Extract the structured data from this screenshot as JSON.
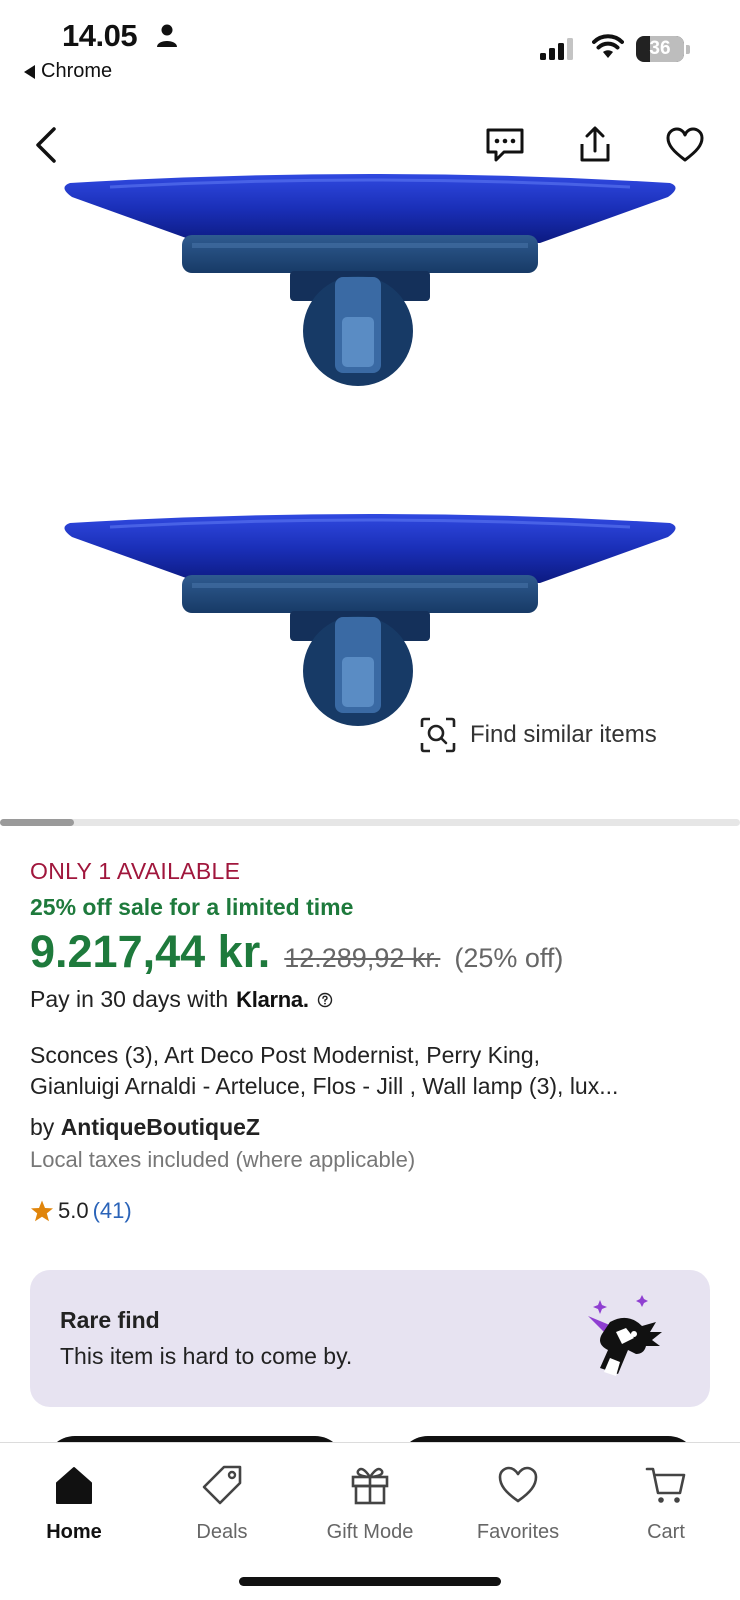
{
  "status_bar": {
    "time": "14.05",
    "back_app": "Chrome",
    "battery": "36"
  },
  "gallery": {
    "find_similar": "Find similar items",
    "image_index": 1,
    "image_count": 10
  },
  "listing": {
    "availability": "ONLY 1 AVAILABLE",
    "sale_note": "25% off sale for a limited time",
    "price": "9.217,44 kr.",
    "original_price": "12.289,92 kr.",
    "discount": "(25% off)",
    "pay_later_text": "Pay in 30 days with",
    "klarna": "Klarna.",
    "title_line1": "Sconces (3), Art Deco Post Modernist, Perry King,",
    "title_line2": "Gianluigi Arnaldi - Arteluce, Flos - Jill , Wall lamp (3), lux...",
    "by_label": "by",
    "seller": "AntiqueBoutiqueZ",
    "taxes_note": "Local taxes included (where applicable)",
    "rating": "5.0",
    "review_count": "(41)"
  },
  "rare_find": {
    "title": "Rare find",
    "subtitle": "This item is hard to come by."
  },
  "tab_bar": {
    "home": "Home",
    "deals": "Deals",
    "gift_mode": "Gift Mode",
    "favorites": "Favorites",
    "cart": "Cart"
  },
  "colors": {
    "sale_green": "#1e7a3c",
    "availability_red": "#a0163c",
    "link_blue": "#2a63b8",
    "rare_card_bg": "#e7e3f1",
    "lamp_blue": "#1a2fb8"
  },
  "icons": [
    "person-icon",
    "signal-icon",
    "wifi-icon",
    "battery-icon",
    "back-arrow-icon",
    "chat-icon",
    "share-icon",
    "heart-icon",
    "visual-search-icon",
    "help-icon",
    "star-icon",
    "unicorn-icon",
    "home-icon",
    "tag-icon",
    "gift-icon",
    "favorites-heart-icon",
    "cart-icon"
  ]
}
